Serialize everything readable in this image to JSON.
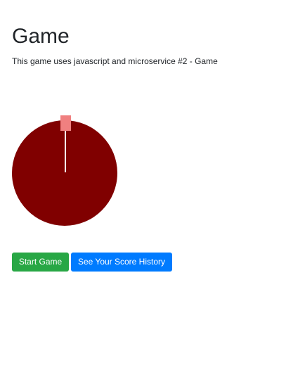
{
  "page": {
    "title": "Game",
    "subtitle": "This game uses javascript and microservice #2 - Game"
  },
  "game": {
    "wheel_color": "#800000",
    "needle_color": "#ffffff",
    "marker_color": "#f08080"
  },
  "actions": {
    "start_label": "Start Game",
    "history_label": "See Your Score History",
    "start_color": "#28a745",
    "history_color": "#007bff"
  }
}
